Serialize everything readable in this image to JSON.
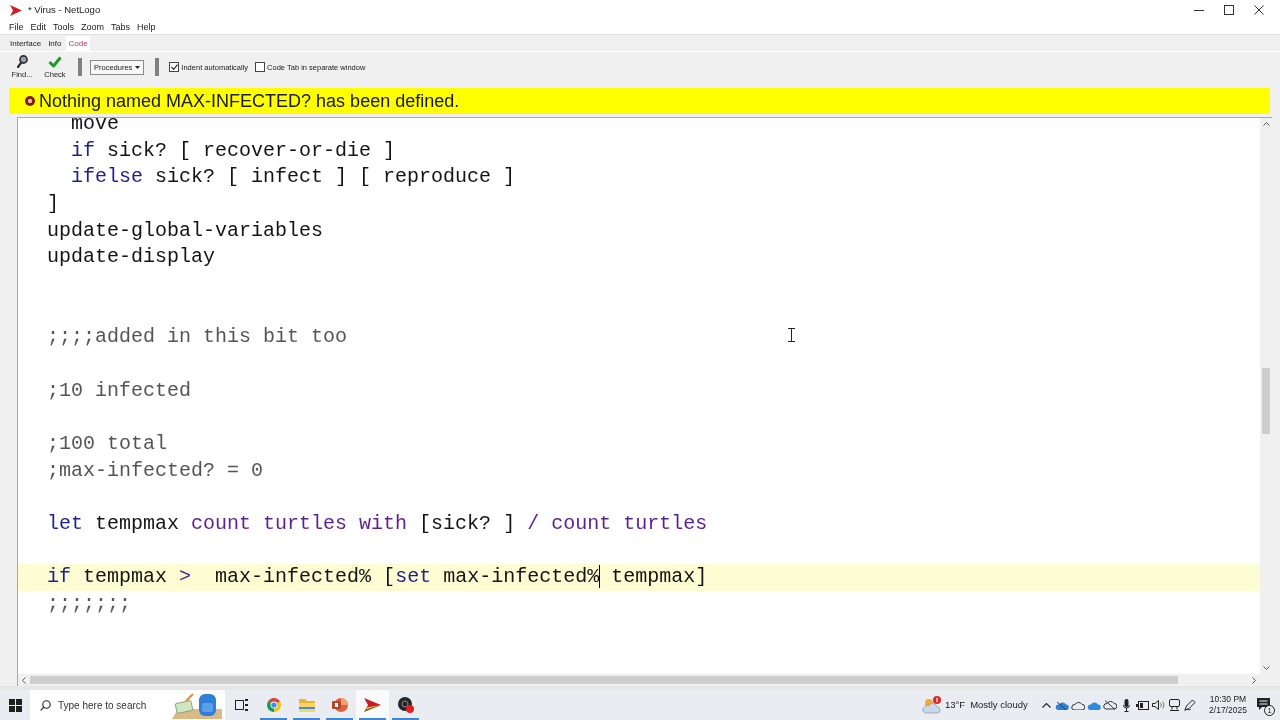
{
  "window": {
    "title": "* Virus - NetLogo"
  },
  "menu": [
    {
      "label": "File"
    },
    {
      "label": "Edit"
    },
    {
      "label": "Tools"
    },
    {
      "label": "Zoom"
    },
    {
      "label": "Tabs"
    },
    {
      "label": "Help"
    }
  ],
  "tabs": [
    {
      "label": "Interface",
      "selected": false
    },
    {
      "label": "Info",
      "selected": false
    },
    {
      "label": "Code",
      "selected": true
    }
  ],
  "toolbar": {
    "buttons": [
      {
        "kind": "find",
        "label": "Find..."
      },
      {
        "kind": "check",
        "label": "Check"
      }
    ],
    "dropdown": {
      "label": "Procedures"
    },
    "options": [
      {
        "label": "Indent automatically",
        "checked": true
      },
      {
        "label": "Code Tab in separate window",
        "checked": false
      }
    ]
  },
  "error_bar": {
    "message": "Nothing named MAX-INFECTED? has been defined."
  },
  "editor": {
    "lines": [
      {
        "current": false,
        "tokens": [
          {
            "text": "    move",
            "kind": "plain"
          }
        ]
      },
      {
        "current": false,
        "tokens": [
          {
            "text": "    if",
            "kind": "command"
          },
          {
            "text": " sick? [ recover-or-die ]",
            "kind": "plain"
          }
        ]
      },
      {
        "current": false,
        "tokens": [
          {
            "text": "    ifelse",
            "kind": "command"
          },
          {
            "text": " sick? [ infect ] [ reproduce ]",
            "kind": "plain"
          }
        ]
      },
      {
        "current": false,
        "tokens": [
          {
            "text": "  ]",
            "kind": "plain"
          }
        ]
      },
      {
        "current": false,
        "tokens": [
          {
            "text": "  update-global-variables",
            "kind": "plain"
          }
        ]
      },
      {
        "current": false,
        "tokens": [
          {
            "text": "  update-display",
            "kind": "plain"
          }
        ]
      },
      {
        "current": false
      },
      {
        "current": false
      },
      {
        "current": false,
        "tokens": [
          {
            "text": "  ;;;;added in this bit too",
            "kind": "comment"
          }
        ]
      },
      {
        "current": false
      },
      {
        "current": false,
        "tokens": [
          {
            "text": "  ;10 infected",
            "kind": "comment"
          }
        ]
      },
      {
        "current": false
      },
      {
        "current": false,
        "tokens": [
          {
            "text": "  ;100 total",
            "kind": "comment"
          }
        ]
      },
      {
        "current": false,
        "tokens": [
          {
            "text": "  ;max-infected? = 0",
            "kind": "comment"
          }
        ]
      },
      {
        "current": false
      },
      {
        "current": false,
        "tokens": [
          {
            "text": "  let",
            "kind": "command"
          },
          {
            "text": " tempmax ",
            "kind": "plain"
          },
          {
            "text": "count turtles with",
            "kind": "reporter"
          },
          {
            "text": " [sick? ] ",
            "kind": "plain"
          },
          {
            "text": "/ count turtles",
            "kind": "reporter"
          }
        ]
      },
      {
        "current": false
      },
      {
        "current": true,
        "tokens": [
          {
            "text": "  if",
            "kind": "command"
          },
          {
            "text": " tempmax ",
            "kind": "plain"
          },
          {
            "text": ">",
            "kind": "reporter"
          },
          {
            "text": "  max-infected% [",
            "kind": "plain"
          },
          {
            "text": "set",
            "kind": "command"
          },
          {
            "text": " max-infected%",
            "kind": "plain"
          },
          {
            "kind": "caret"
          },
          {
            "text": " tempmax]",
            "kind": "plain"
          }
        ]
      },
      {
        "current": false,
        "tokens": [
          {
            "text": "  ;;;;;;;",
            "kind": "comment"
          }
        ]
      },
      {
        "current": false
      },
      {
        "current": false
      }
    ]
  },
  "taskbar": {
    "search": {
      "placeholder": "Type here to search"
    },
    "apps": [
      {
        "kind": "browser",
        "active": false,
        "running": true
      },
      {
        "kind": "folder",
        "active": false,
        "running": true
      },
      {
        "kind": "slides",
        "active": false,
        "running": true
      },
      {
        "kind": "modeler",
        "active": true,
        "running": true
      },
      {
        "kind": "recorder",
        "active": false,
        "running": true
      }
    ],
    "weather": {
      "temperature": "13°F",
      "condition": "Mostly cloudy"
    },
    "clock": {
      "time": "10:30 PM",
      "date": "2/17/2025"
    },
    "notifications": {
      "count": "1"
    }
  }
}
